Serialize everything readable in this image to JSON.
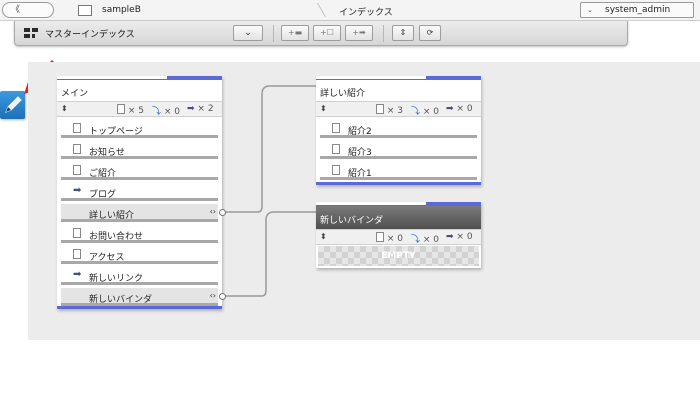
{
  "topbar": {
    "back_label": "《",
    "site_name": "sampleB",
    "page_name": "インデックス",
    "user_chevron": "⌄",
    "user_name": "system_admin"
  },
  "toolbar": {
    "title": "マスターインデックス",
    "dropdown_glyph": "⌄",
    "add_folder_glyph": "+▬",
    "add_page_glyph": "+☐",
    "add_link_glyph": "+➡",
    "collapse_glyph": "⇕",
    "sync_glyph": "⟳"
  },
  "menu_panel": {
    "title": "メイン",
    "updown": "⬍",
    "stats": {
      "pages": "× 5",
      "links_in": "× 0",
      "links_out": "× 2"
    },
    "items": [
      {
        "label": "トップページ",
        "kind": "page"
      },
      {
        "label": "お知らせ",
        "kind": "page"
      },
      {
        "label": "ご紹介",
        "kind": "page"
      },
      {
        "label": "ブログ",
        "kind": "link"
      },
      {
        "label": "詳しい紹介",
        "kind": "folder",
        "handle": "‹›"
      },
      {
        "label": "お問い合わせ",
        "kind": "page"
      },
      {
        "label": "アクセス",
        "kind": "page"
      },
      {
        "label": "新しいリンク",
        "kind": "link"
      },
      {
        "label": "新しいバインダ",
        "kind": "folder",
        "handle": "‹›"
      }
    ]
  },
  "detail_panel": {
    "title": "詳しい紹介",
    "updown": "⬍",
    "stats": {
      "pages": "× 3",
      "links_in": "× 0",
      "links_out": "× 0"
    },
    "items": [
      {
        "label": "紹介2"
      },
      {
        "label": "紹介3"
      },
      {
        "label": "紹介1"
      }
    ]
  },
  "binder_panel": {
    "title": "新しいバインダ",
    "updown": "⬍",
    "stats": {
      "pages": "× 0",
      "links_in": "× 0",
      "links_out": "× 0"
    },
    "empty_label": "EMPTY"
  },
  "colors": {
    "accent_blue": "#5b6ad8",
    "edit_button": "#2a84cf",
    "arrow_red": "#ee1c1c",
    "canvas_bg": "#ececec"
  }
}
